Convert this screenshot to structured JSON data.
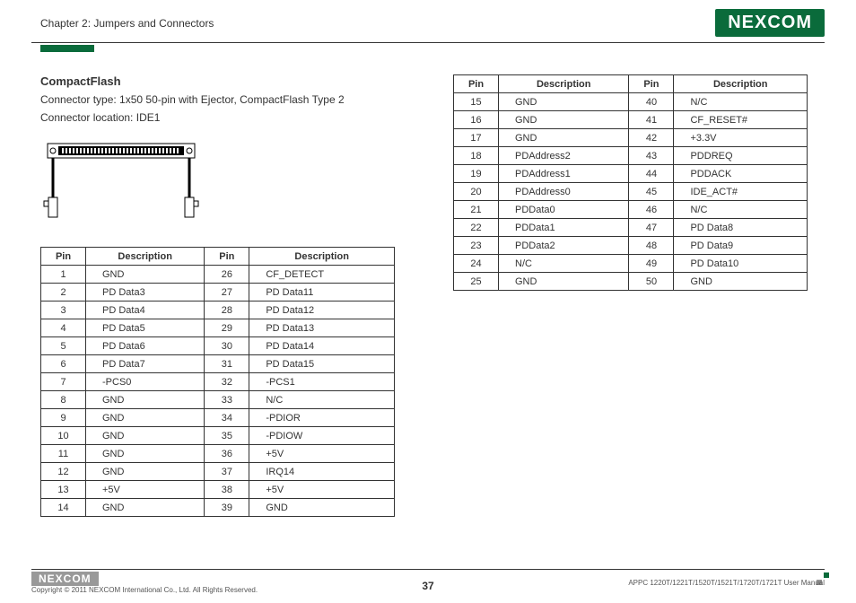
{
  "header": {
    "chapter": "Chapter 2: Jumpers and Connectors",
    "logo": "NEXCOM"
  },
  "section": {
    "title": "CompactFlash",
    "line1": "Connector type: 1x50 50-pin with Ejector, CompactFlash Type 2",
    "line2": "Connector location: IDE1"
  },
  "table1": {
    "headers": [
      "Pin",
      "Description",
      "Pin",
      "Description"
    ],
    "rows": [
      [
        "1",
        "GND",
        "26",
        "CF_DETECT"
      ],
      [
        "2",
        "PD Data3",
        "27",
        "PD Data11"
      ],
      [
        "3",
        "PD Data4",
        "28",
        "PD Data12"
      ],
      [
        "4",
        "PD Data5",
        "29",
        "PD Data13"
      ],
      [
        "5",
        "PD Data6",
        "30",
        "PD Data14"
      ],
      [
        "6",
        "PD Data7",
        "31",
        "PD Data15"
      ],
      [
        "7",
        "-PCS0",
        "32",
        "-PCS1"
      ],
      [
        "8",
        "GND",
        "33",
        "N/C"
      ],
      [
        "9",
        "GND",
        "34",
        "-PDIOR"
      ],
      [
        "10",
        "GND",
        "35",
        "-PDIOW"
      ],
      [
        "11",
        "GND",
        "36",
        "+5V"
      ],
      [
        "12",
        "GND",
        "37",
        "IRQ14"
      ],
      [
        "13",
        "+5V",
        "38",
        "+5V"
      ],
      [
        "14",
        "GND",
        "39",
        "GND"
      ]
    ]
  },
  "table2": {
    "headers": [
      "Pin",
      "Description",
      "Pin",
      "Description"
    ],
    "rows": [
      [
        "15",
        "GND",
        "40",
        "N/C"
      ],
      [
        "16",
        "GND",
        "41",
        "CF_RESET#"
      ],
      [
        "17",
        "GND",
        "42",
        "+3.3V"
      ],
      [
        "18",
        "PDAddress2",
        "43",
        "PDDREQ"
      ],
      [
        "19",
        "PDAddress1",
        "44",
        "PDDACK"
      ],
      [
        "20",
        "PDAddress0",
        "45",
        "IDE_ACT#"
      ],
      [
        "21",
        "PDData0",
        "46",
        "N/C"
      ],
      [
        "22",
        "PDData1",
        "47",
        "PD Data8"
      ],
      [
        "23",
        "PDData2",
        "48",
        "PD Data9"
      ],
      [
        "24",
        "N/C",
        "49",
        "PD Data10"
      ],
      [
        "25",
        "GND",
        "50",
        "GND"
      ]
    ]
  },
  "footer": {
    "logo": "NEXCOM",
    "copyright": "Copyright © 2011 NEXCOM International Co., Ltd. All Rights Reserved.",
    "page": "37",
    "manual": "APPC 1220T/1221T/1520T/1521T/1720T/1721T User Manual"
  }
}
